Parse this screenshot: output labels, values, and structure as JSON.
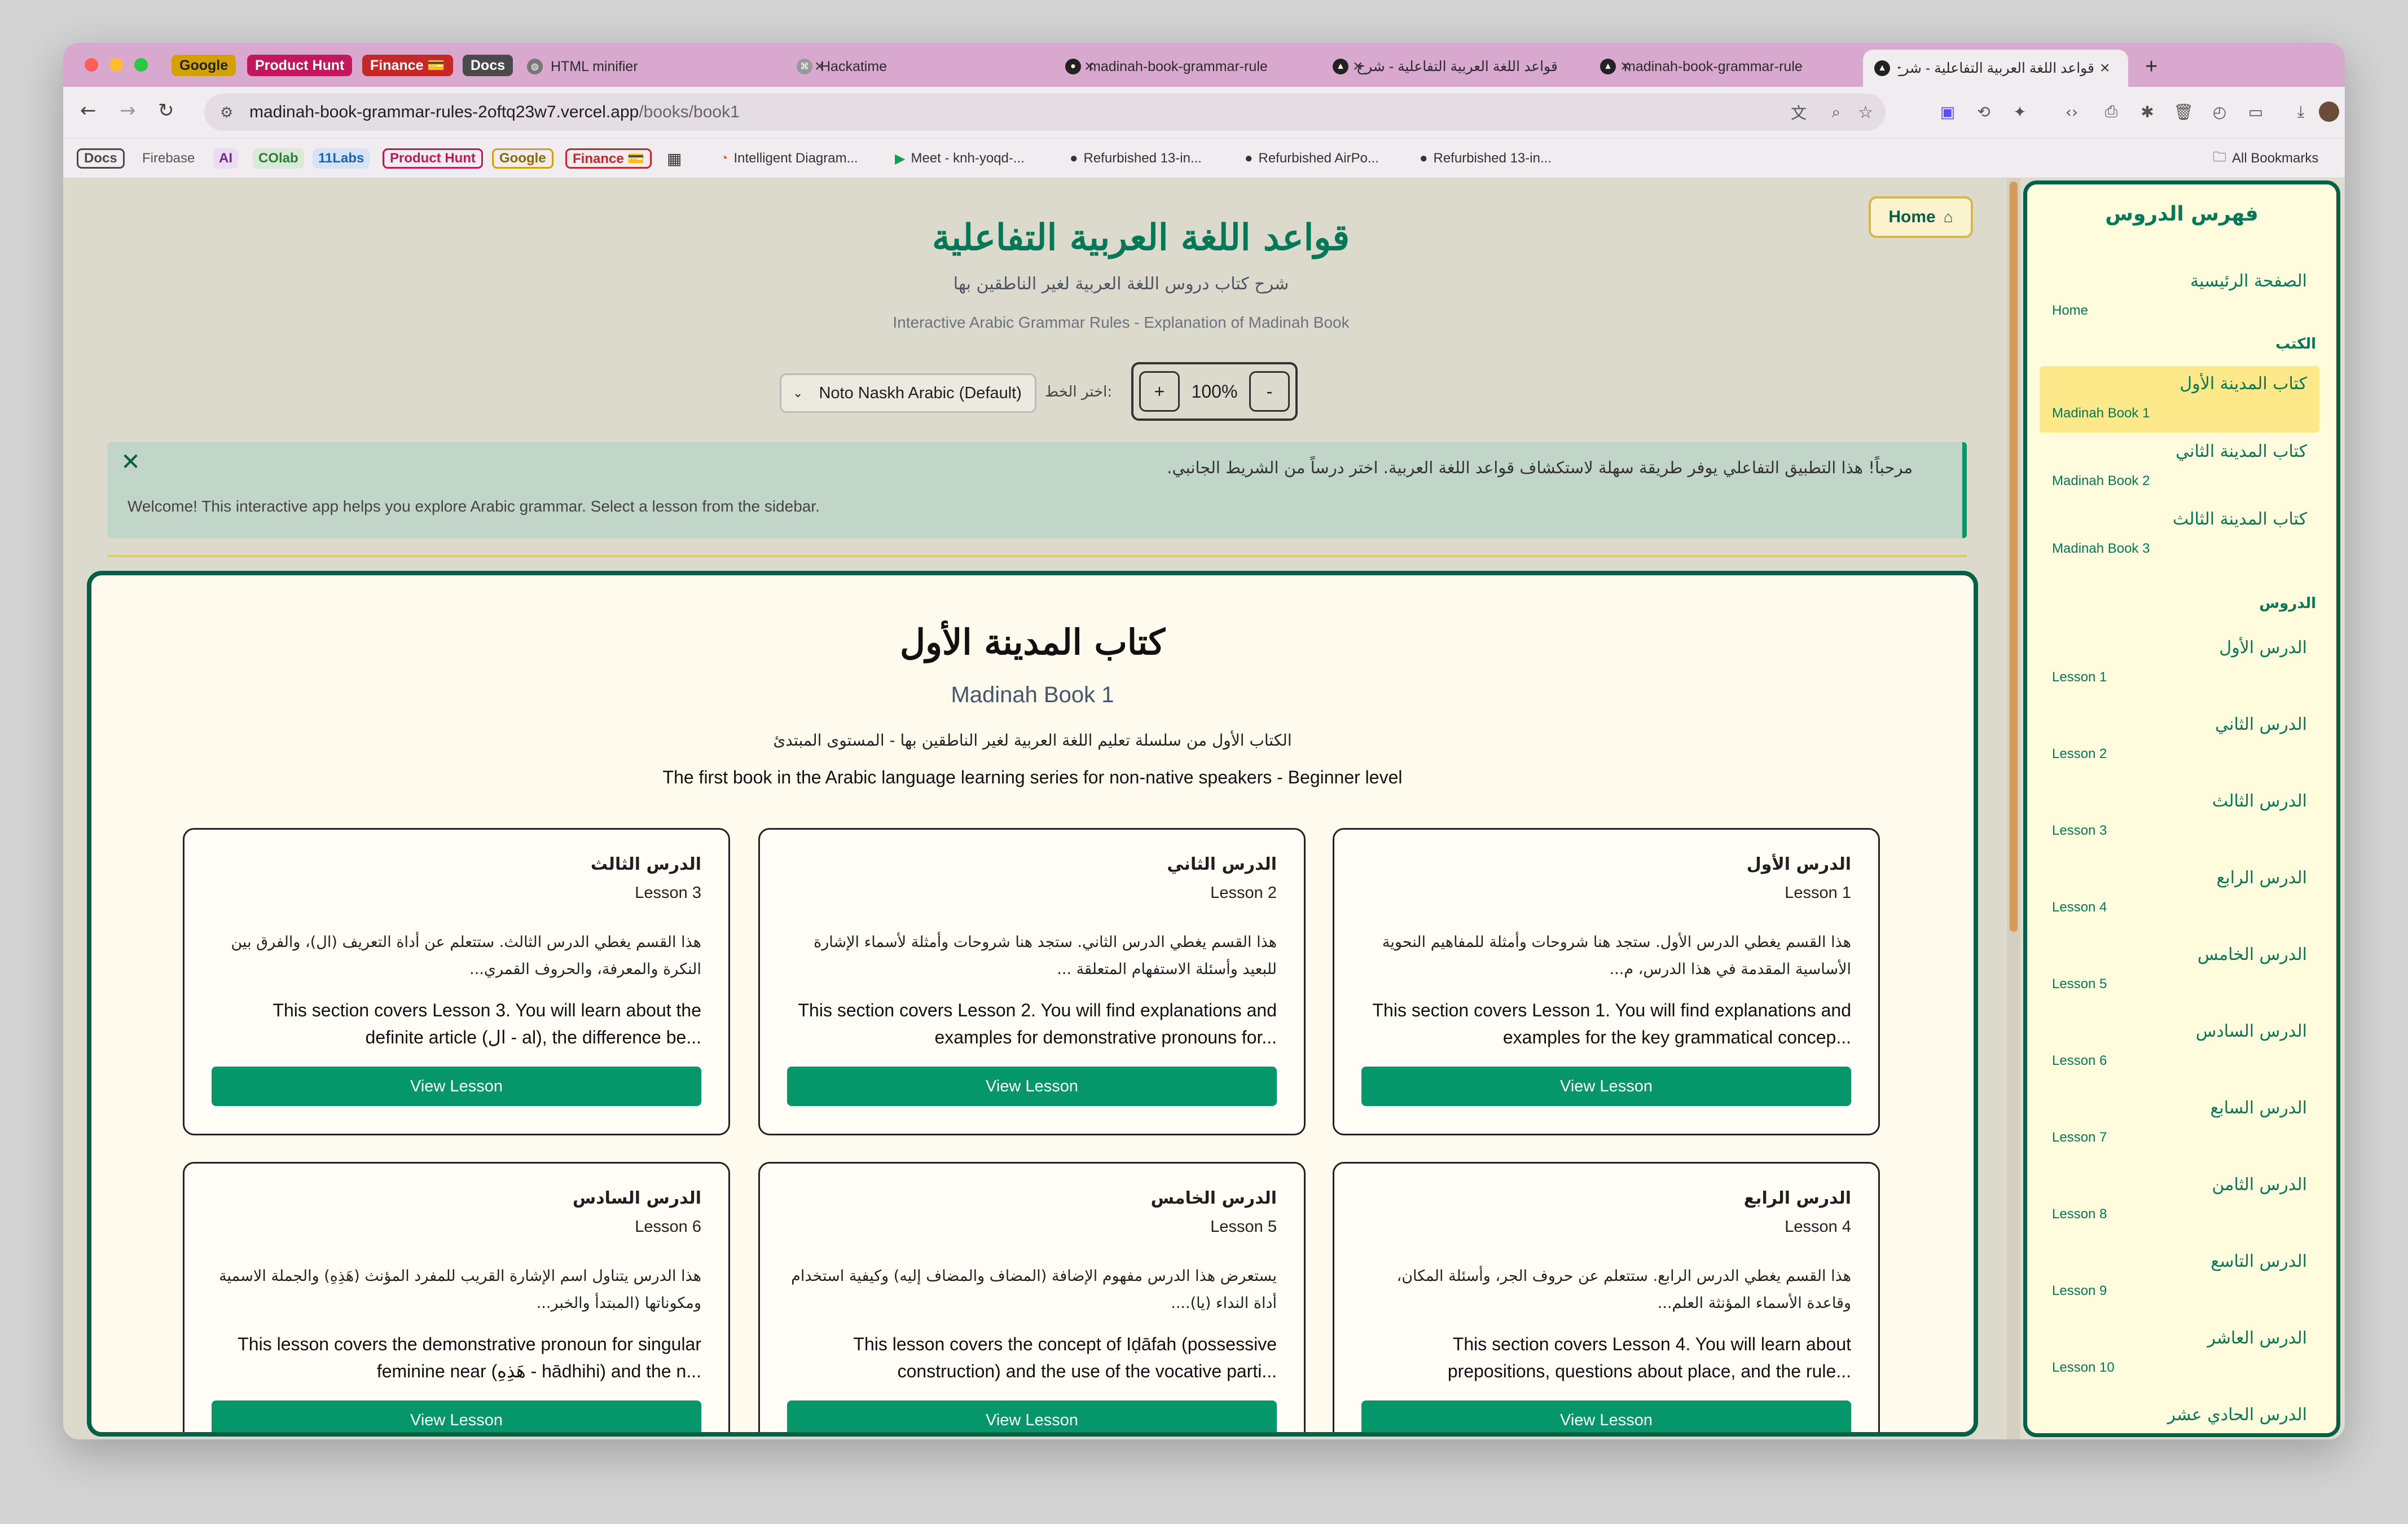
{
  "browser": {
    "tab_groups": [
      {
        "label": "Google",
        "color": "#d2a300",
        "text": "#222222"
      },
      {
        "label": "Product Hunt",
        "color": "#c2185b",
        "text": "#ffffff"
      },
      {
        "label": "Finance 💳",
        "color": "#c62828",
        "text": "#ffffff"
      },
      {
        "label": "Docs",
        "color": "#4a4a4a",
        "text": "#ffffff"
      }
    ],
    "tabs": [
      {
        "title": "HTML minifier",
        "icon": "globe-icon"
      },
      {
        "title": "Hackatime",
        "icon": "hackatime-icon"
      },
      {
        "title": "madinah-book-grammar-rule",
        "icon": "github-icon"
      },
      {
        "title": "قواعد اللغة العربية التفاعلية - شرح",
        "icon": "vercel-icon"
      },
      {
        "title": "madinah-book-grammar-rule",
        "icon": "vercel-icon"
      },
      {
        "title": "قواعد اللغة العربية التفاعلية - شرح",
        "icon": "vercel-icon",
        "active": true
      }
    ],
    "new_tab": "+",
    "url_host": "madinah-book-grammar-rules-2oftq23w7.vercel.app",
    "url_path": "/books/book1",
    "bookmarks": {
      "chips": [
        {
          "label": "Docs",
          "color": "#4a4a4a"
        },
        {
          "label": "Firebase",
          "color": "none"
        },
        {
          "label": "AI",
          "color": "#7b1fa2"
        },
        {
          "label": "COlab",
          "color": "#2e7d32"
        },
        {
          "label": "11Labs",
          "color": "#1565c0"
        },
        {
          "label": "Product Hunt",
          "color": "#c2185b"
        },
        {
          "label": "Google",
          "color": "#d2a300"
        },
        {
          "label": "Finance 💳",
          "color": "#c62828"
        }
      ],
      "links": [
        "Intelligent Diagram...",
        "Meet - knh-yoqd-...",
        "Refurbished 13-in...",
        "Refurbished AirPo...",
        "Refurbished 13-in..."
      ],
      "all": "All Bookmarks"
    }
  },
  "header": {
    "title_ar": "قواعد اللغة العربية التفاعلية",
    "subtitle_ar": "شرح كتاب دروس اللغة العربية لغير الناطقين بها",
    "subtitle_en": "Interactive Arabic Grammar Rules - Explanation of Madinah Book",
    "home": "Home"
  },
  "controls": {
    "font_label": "اختر الخط:",
    "font_value": "Noto Naskh Arabic (Default)",
    "zoom_plus": "+",
    "zoom_value": "100%",
    "zoom_minus": "-"
  },
  "welcome": {
    "ar": "مرحباً! هذا التطبيق التفاعلي يوفر طريقة سهلة لاستكشاف قواعد اللغة العربية. اختر درساً من الشريط الجانبي.",
    "en": "Welcome! This interactive app helps you explore Arabic grammar. Select a lesson from the sidebar.",
    "close": "✕"
  },
  "book": {
    "title_ar": "كتاب المدينة الأول",
    "title_en": "Madinah Book 1",
    "desc_ar": "الكتاب الأول من سلسلة تعليم اللغة العربية لغير الناطقين بها - المستوى المبتدئ",
    "desc_en": "The first book in the Arabic language learning series for non-native speakers - Beginner level",
    "view_label": "View Lesson",
    "lessons": [
      {
        "ar": "الدرس الأول",
        "en": "Lesson 1",
        "desc_ar": "هذا القسم يغطي الدرس الأول. ستجد هنا شروحات وأمثلة للمفاهيم النحوية الأساسية المقدمة في هذا الدرس، م...",
        "desc_en": "This section covers Lesson 1. You will find explanations and examples for the key grammatical concep..."
      },
      {
        "ar": "الدرس الثاني",
        "en": "Lesson 2",
        "desc_ar": "هذا القسم يغطي الدرس الثاني. ستجد هنا شروحات وأمثلة لأسماء الإشارة للبعيد وأسئلة الاستفهام المتعلقة ...",
        "desc_en": "This section covers Lesson 2. You will find explanations and examples for demonstrative pronouns for..."
      },
      {
        "ar": "الدرس الثالث",
        "en": "Lesson 3",
        "desc_ar": "هذا القسم يغطي الدرس الثالث. ستتعلم عن أداة التعريف (ال)، والفرق بين النكرة والمعرفة، والحروف القمري...",
        "desc_en": "This section covers Lesson 3. You will learn about the definite article (ال - al), the difference be..."
      },
      {
        "ar": "الدرس الرابع",
        "en": "Lesson 4",
        "desc_ar": "هذا القسم يغطي الدرس الرابع. ستتعلم عن حروف الجر، وأسئلة المكان، وقاعدة الأسماء المؤنثة العلم...",
        "desc_en": "This section covers Lesson 4. You will learn about prepositions, questions about place, and the rule..."
      },
      {
        "ar": "الدرس الخامس",
        "en": "Lesson 5",
        "desc_ar": "يستعرض هذا الدرس مفهوم الإضافة (المضاف والمضاف إليه) وكيفية استخدام أداة النداء (يا)....",
        "desc_en": "This lesson covers the concept of Iḍāfah (possessive construction) and the use of the vocative parti..."
      },
      {
        "ar": "الدرس السادس",
        "en": "Lesson 6",
        "desc_ar": "هذا الدرس يتناول اسم الإشارة القريب للمفرد المؤنث (هَذِهِ) والجملة الاسمية ومكوناتها (المبتدأ والخبر...",
        "desc_en": "This lesson covers the demonstrative pronoun for singular feminine near (هَذِهِ - hādhihi) and the n..."
      }
    ]
  },
  "sidebar": {
    "title": "فهرس الدروس",
    "home_ar": "الصفحة الرئيسية",
    "home_en": "Home",
    "books_heading": "الكتب",
    "books": [
      {
        "ar": "كتاب المدينة الأول",
        "en": "Madinah Book 1",
        "active": true
      },
      {
        "ar": "كتاب المدينة الثاني",
        "en": "Madinah Book 2"
      },
      {
        "ar": "كتاب المدينة الثالث",
        "en": "Madinah Book 3"
      }
    ],
    "lessons_heading": "الدروس",
    "lessons": [
      {
        "ar": "الدرس الأول",
        "en": "Lesson 1"
      },
      {
        "ar": "الدرس الثاني",
        "en": "Lesson 2"
      },
      {
        "ar": "الدرس الثالث",
        "en": "Lesson 3"
      },
      {
        "ar": "الدرس الرابع",
        "en": "Lesson 4"
      },
      {
        "ar": "الدرس الخامس",
        "en": "Lesson 5"
      },
      {
        "ar": "الدرس السادس",
        "en": "Lesson 6"
      },
      {
        "ar": "الدرس السابع",
        "en": "Lesson 7"
      },
      {
        "ar": "الدرس الثامن",
        "en": "Lesson 8"
      },
      {
        "ar": "الدرس التاسع",
        "en": "Lesson 9"
      },
      {
        "ar": "الدرس العاشر",
        "en": "Lesson 10"
      },
      {
        "ar": "الدرس الحادي عشر",
        "en": ""
      }
    ]
  },
  "colors": {
    "accent": "#059669",
    "dark_green": "#065f46",
    "highlight": "#fde88a"
  }
}
